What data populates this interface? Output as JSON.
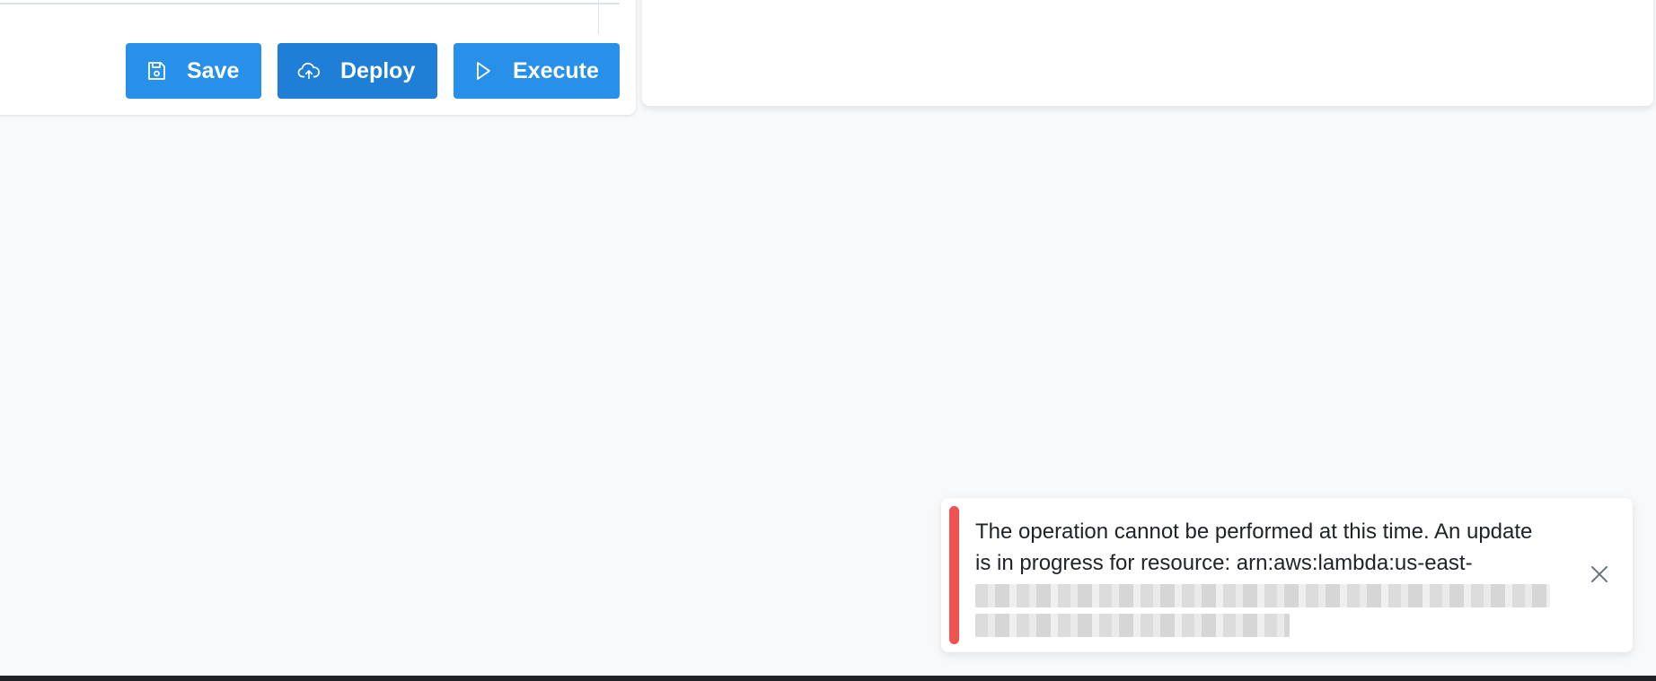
{
  "toolbar": {
    "save_label": "Save",
    "deploy_label": "Deploy",
    "execute_label": "Execute"
  },
  "icons": {
    "save": "floppy-disk-icon",
    "deploy": "cloud-upload-icon",
    "execute": "play-icon",
    "close": "close-icon"
  },
  "toast": {
    "type": "error",
    "message_line1": "The operation cannot be performed at this time. An update",
    "message_line2": "is in progress for resource: arn:aws:lambda:us-east-"
  },
  "colors": {
    "primary": "#2890e8",
    "primary_dark": "#1f7fd6",
    "error": "#f05252",
    "background": "#f7f9fb"
  }
}
